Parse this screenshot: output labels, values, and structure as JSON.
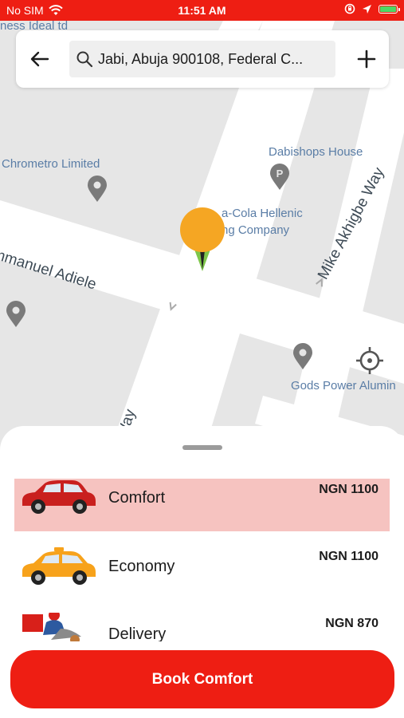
{
  "status_bar": {
    "carrier": "No SIM",
    "time": "11:51 AM",
    "colors": {
      "background": "#ee1e13",
      "battery": "#4cd964"
    }
  },
  "search": {
    "query": "Jabi, Abuja 900108, Federal C...",
    "back_icon": "arrow-left-icon",
    "add_icon": "plus-icon"
  },
  "map": {
    "labels": {
      "top_left_partial": "ness Ideal td",
      "chrometro": "Chrometro Limited",
      "dabishops": "Dabishops House",
      "coca_cola_line1": "a-Cola Hellenic",
      "coca_cola_line2": "ng Company",
      "gods_power": "Gods Power Alumin",
      "road_emmanuel": "mmanuel Adiele",
      "road_mike": "Mike Akhigbe Way",
      "road_way": "Way"
    },
    "colors": {
      "road": "#ffffff",
      "land": "#e6e6e6",
      "poi": "#7a7a7a",
      "marker": "#f5a623"
    }
  },
  "ride_options": [
    {
      "name": "Comfort",
      "price": "NGN 1100",
      "vehicle_icon": "red-car-icon",
      "selected": true
    },
    {
      "name": "Economy",
      "price": "NGN 1100",
      "vehicle_icon": "yellow-taxi-icon",
      "selected": false
    },
    {
      "name": "Delivery",
      "price": "NGN 870",
      "vehicle_icon": "delivery-scooter-icon",
      "selected": false
    }
  ],
  "book_button": {
    "label": "Book Comfort",
    "color": "#ee1e13"
  }
}
